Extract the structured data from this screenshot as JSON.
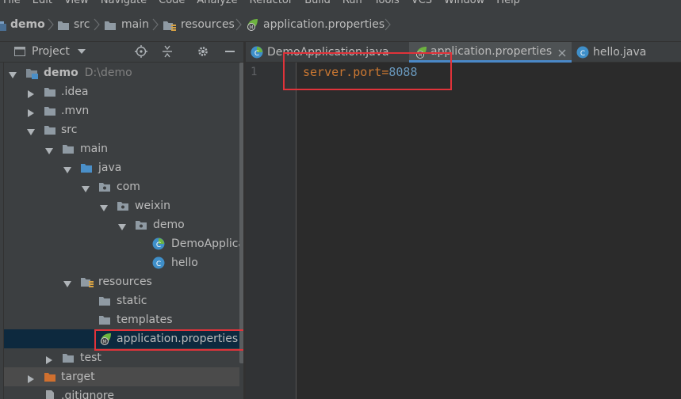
{
  "menu": [
    "File",
    "Edit",
    "View",
    "Navigate",
    "Code",
    "Analyze",
    "Refactor",
    "Build",
    "Run",
    "Tools",
    "VCS",
    "Window",
    "Help"
  ],
  "breadcrumbs": [
    "demo",
    "src",
    "main",
    "resources",
    "application.properties"
  ],
  "project_panel": {
    "title": "Project"
  },
  "tree": {
    "root": {
      "name": "demo",
      "path": "D:\\demo"
    },
    "idea": ".idea",
    "mvn": ".mvn",
    "src": "src",
    "main": "main",
    "java": "java",
    "com": "com",
    "weixin": "weixin",
    "demo_pkg": "demo",
    "demo_app": "DemoApplica",
    "hello": "hello",
    "resources": "resources",
    "static": "static",
    "templates": "templates",
    "app_props": "application.properties",
    "test": "test",
    "target": "target",
    "gitignore": ".gitignore"
  },
  "tabs": [
    {
      "label": "DemoApplication.java",
      "active": false
    },
    {
      "label": "application.properties",
      "active": true
    },
    {
      "label": "hello.java",
      "active": false
    }
  ],
  "editor": {
    "line_number": "1",
    "key": "server.port",
    "equals": "=",
    "value": "8088"
  },
  "colors": {
    "highlight_box": "#e0333a",
    "keyword": "#cc7832",
    "number": "#6897bb",
    "folder": "#4a8fc8",
    "spring": "#6db33f"
  }
}
